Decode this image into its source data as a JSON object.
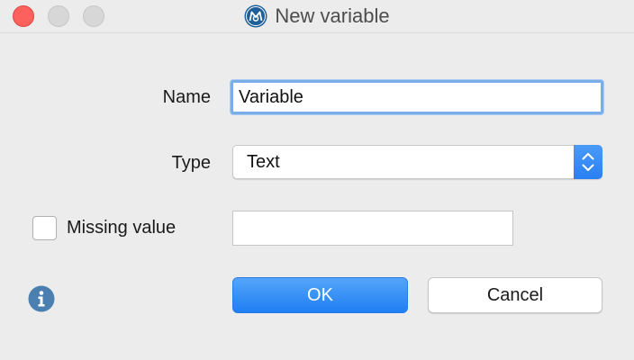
{
  "window": {
    "title": "New variable",
    "app_icon": "maxqda-logo-icon"
  },
  "form": {
    "name_label": "Name",
    "name_value": "Variable",
    "type_label": "Type",
    "type_selected": "Text",
    "missing_label": "Missing value",
    "missing_checked": false,
    "missing_value": ""
  },
  "buttons": {
    "ok_label": "OK",
    "cancel_label": "Cancel"
  },
  "icons": {
    "info": "info-icon",
    "stepper": "chevron-up-down-icon"
  },
  "colors": {
    "accent": "#2a7ff3",
    "close": "#fc615d",
    "info": "#4a7fb0"
  }
}
